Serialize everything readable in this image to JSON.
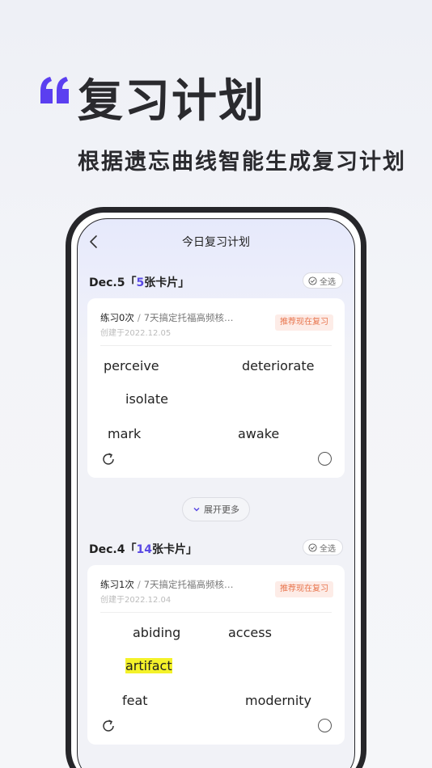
{
  "headline": {
    "title": "复习计划",
    "subtitle": "根据遗忘曲线智能生成复习计划",
    "accent_color": "#5b3ff0"
  },
  "nav": {
    "title": "今日复习计划",
    "back_icon": "chevron-left-icon"
  },
  "sections": [
    {
      "date": "Dec.5「",
      "count": "5",
      "count_suffix": "张卡片」",
      "select_all": "全选",
      "card": {
        "practice": "练习0次",
        "separator": "/",
        "book": "7天搞定托福高频核…",
        "created": "创建于2022.12.05",
        "badge": "推荐现在复习",
        "words": [
          "perceive",
          "deteriorate",
          "isolate",
          "mark",
          "awake"
        ]
      }
    },
    {
      "date": "Dec.4「",
      "count": "14",
      "count_suffix": "张卡片」",
      "select_all": "全选",
      "card": {
        "practice": "练习1次",
        "separator": "/",
        "book": "7天搞定托福高频核…",
        "created": "创建于2022.12.04",
        "badge": "推荐现在复习",
        "words": [
          "abiding",
          "access",
          "artifact",
          "feat",
          "modernity"
        ],
        "highlighted_word": "artifact"
      }
    }
  ],
  "expand_more": "展开更多",
  "colors": {
    "count": "#5a4ae3",
    "badge_text": "#e8754d",
    "badge_bg": "#fdece7",
    "highlight": "#f4f22a"
  }
}
